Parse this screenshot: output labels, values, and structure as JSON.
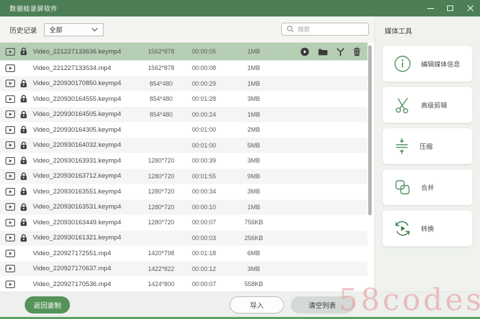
{
  "titlebar": {
    "title": "数据蛙录屏软件"
  },
  "toolbar": {
    "history_label": "历史记录",
    "history_value": "全部",
    "search_placeholder": "搜索"
  },
  "panel": {
    "title": "媒体工具",
    "tools": [
      {
        "label": "编辑媒体信息",
        "icon": "info-icon"
      },
      {
        "label": "高级剪辑",
        "icon": "scissors-icon"
      },
      {
        "label": "压缩",
        "icon": "compress-icon"
      },
      {
        "label": "合并",
        "icon": "merge-icon"
      },
      {
        "label": "转换",
        "icon": "convert-icon"
      }
    ]
  },
  "list": {
    "selected_row_actions": [
      "play-icon",
      "folder-icon",
      "wrench-icon",
      "trash-icon"
    ],
    "rows": [
      {
        "name": "Video_221227133636.keymp4",
        "resolution": "1562*878",
        "duration": "00:00:05",
        "size": "1MB",
        "locked": true,
        "selected": true
      },
      {
        "name": "Video_221227133534.mp4",
        "resolution": "1562*878",
        "duration": "00:00:08",
        "size": "1MB",
        "locked": false,
        "selected": false
      },
      {
        "name": "Video_220930170850.keymp4",
        "resolution": "854*480",
        "duration": "00:00:29",
        "size": "1MB",
        "locked": true,
        "selected": false
      },
      {
        "name": "Video_220930164555.keymp4",
        "resolution": "854*480",
        "duration": "00:01:28",
        "size": "3MB",
        "locked": true,
        "selected": false
      },
      {
        "name": "Video_220930164505.keymp4",
        "resolution": "854*480",
        "duration": "00:00:24",
        "size": "1MB",
        "locked": true,
        "selected": false
      },
      {
        "name": "Video_220930164305.keymp4",
        "resolution": "",
        "duration": "00:01:00",
        "size": "2MB",
        "locked": true,
        "selected": false
      },
      {
        "name": "Video_220930164032.keymp4",
        "resolution": "",
        "duration": "00:01:00",
        "size": "5MB",
        "locked": true,
        "selected": false
      },
      {
        "name": "Video_220930163931.keymp4",
        "resolution": "1280*720",
        "duration": "00:00:39",
        "size": "3MB",
        "locked": true,
        "selected": false
      },
      {
        "name": "Video_220930163712.keymp4",
        "resolution": "1280*720",
        "duration": "00:01:55",
        "size": "9MB",
        "locked": true,
        "selected": false
      },
      {
        "name": "Video_220930163551.keymp4",
        "resolution": "1280*720",
        "duration": "00:00:34",
        "size": "3MB",
        "locked": true,
        "selected": false
      },
      {
        "name": "Video_220930163531.keymp4",
        "resolution": "1280*720",
        "duration": "00:00:10",
        "size": "1MB",
        "locked": true,
        "selected": false
      },
      {
        "name": "Video_220930163449.keymp4",
        "resolution": "1280*720",
        "duration": "00:00:07",
        "size": "756KB",
        "locked": true,
        "selected": false
      },
      {
        "name": "Video_220930161321.keymp4",
        "resolution": "",
        "duration": "00:00:03",
        "size": "256KB",
        "locked": true,
        "selected": false
      },
      {
        "name": "Video_220927172551.mp4",
        "resolution": "1420*798",
        "duration": "00:01:18",
        "size": "6MB",
        "locked": false,
        "selected": false
      },
      {
        "name": "Video_220927170637.mp4",
        "resolution": "1422*822",
        "duration": "00:00:12",
        "size": "3MB",
        "locked": false,
        "selected": false
      },
      {
        "name": "Video_220927170536.mp4",
        "resolution": "1424*800",
        "duration": "00:00:07",
        "size": "558KB",
        "locked": false,
        "selected": false
      }
    ]
  },
  "footer": {
    "back_label": "返回录制",
    "import_label": "导入",
    "clear_label": "清空列表"
  },
  "watermark": "58codes",
  "colors": {
    "titlebar": "#4d7f56",
    "accent": "#549359",
    "selected_row": "#b6cfb4",
    "tool_icon": "#4f8f5c"
  }
}
